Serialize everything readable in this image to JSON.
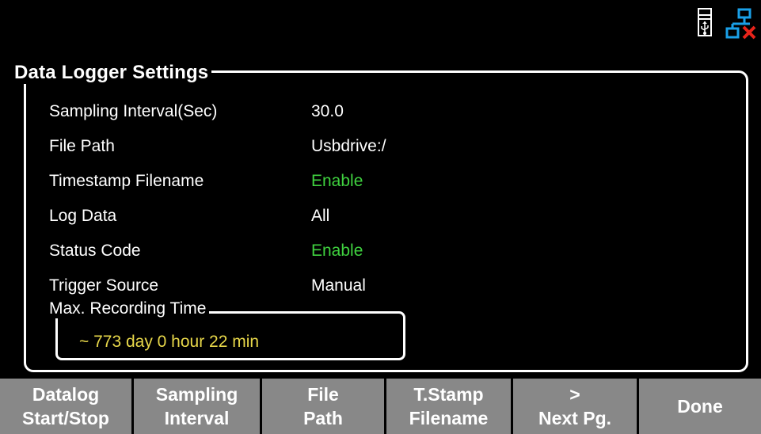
{
  "status": {
    "usb_icon": "usb-drive-icon",
    "lan_icon": "lan-disconnected-icon"
  },
  "panel": {
    "title": "Data Logger Settings"
  },
  "settings": [
    {
      "label": "Sampling Interval(Sec)",
      "value": "30.0",
      "value_color": "#ffffff"
    },
    {
      "label": "File Path",
      "value": "Usbdrive:/",
      "value_color": "#ffffff"
    },
    {
      "label": "Timestamp Filename",
      "value": "Enable",
      "value_color": "#3fd13f"
    },
    {
      "label": "Log Data",
      "value": "All",
      "value_color": "#ffffff"
    },
    {
      "label": "Status Code",
      "value": "Enable",
      "value_color": "#3fd13f"
    },
    {
      "label": "Trigger Source",
      "value": "Manual",
      "value_color": "#ffffff"
    }
  ],
  "recording": {
    "title": "Max. Recording Time",
    "value": "~ 773 day  0 hour  22 min",
    "value_color": "#e8d84a"
  },
  "softkeys": [
    {
      "line1": "Datalog",
      "line2": "Start/Stop"
    },
    {
      "line1": "Sampling",
      "line2": "Interval"
    },
    {
      "line1": "File",
      "line2": "Path"
    },
    {
      "line1": "T.Stamp",
      "line2": "Filename"
    },
    {
      "line1": ">",
      "line2": "Next Pg."
    },
    {
      "line1": "Done",
      "line2": ""
    }
  ],
  "colors": {
    "background": "#000000",
    "enabled": "#3fd13f",
    "highlight": "#e8d84a",
    "softkey_bg": "#888888"
  }
}
